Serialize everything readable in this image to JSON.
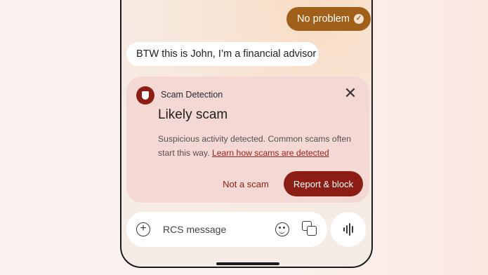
{
  "conversation": {
    "outgoing_message": "No problem",
    "incoming_message": "BTW this is John, I’m a financial advisor"
  },
  "scam_card": {
    "header": "Scam Detection",
    "title": "Likely scam",
    "description": "Suspicious activity detected. Common scams often start this way.",
    "link_text": "Learn how scams are detected",
    "secondary_action": "Not a scam",
    "primary_action": "Report & block"
  },
  "composer": {
    "placeholder": "RCS message"
  },
  "colors": {
    "accent": "#8b1d14",
    "outgoing_bubble": "#a1601a",
    "card_background": "#f4d8d3"
  },
  "icons": {
    "shield": "shield-icon",
    "close": "close-icon",
    "attach": "plus-icon",
    "emoji": "emoji-icon",
    "gallery": "gallery-icon",
    "voice": "voice-waveform-icon",
    "sent": "check-icon"
  }
}
